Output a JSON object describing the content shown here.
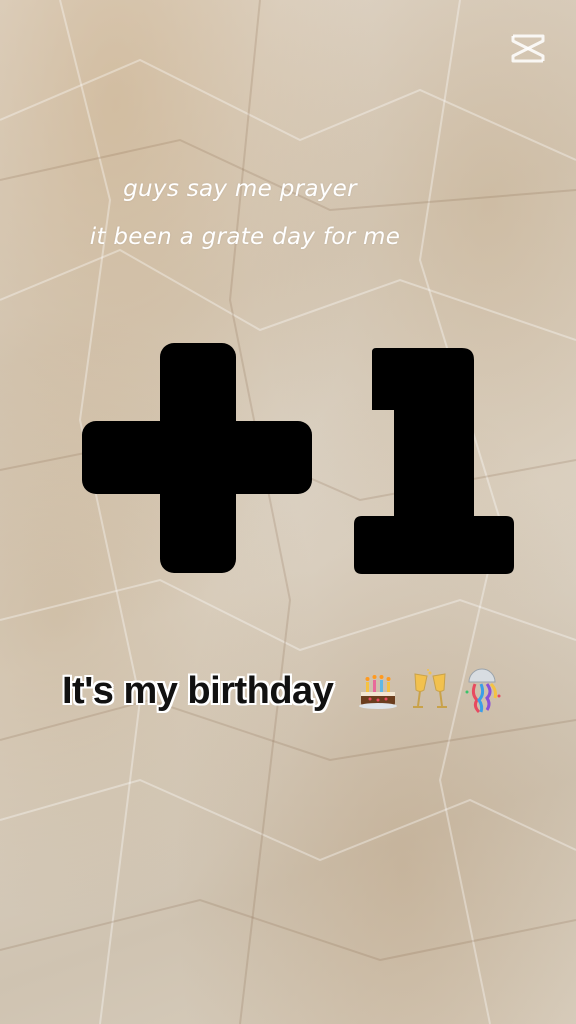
{
  "app": {
    "logo_icon": "capcut-logo-icon"
  },
  "captions": {
    "line1": "guys say me prayer",
    "line2": "it been a grate day for me"
  },
  "headline": {
    "text": "+1"
  },
  "birthday": {
    "text": "It's my birthday",
    "emojis": [
      "birthday-cake-icon",
      "clinking-glasses-icon",
      "confetti-ball-icon"
    ]
  },
  "colors": {
    "paper": "#d9cfbf",
    "caption_text": "#ffffff",
    "headline_fill": "#000000",
    "birthday_text": "#111111"
  }
}
